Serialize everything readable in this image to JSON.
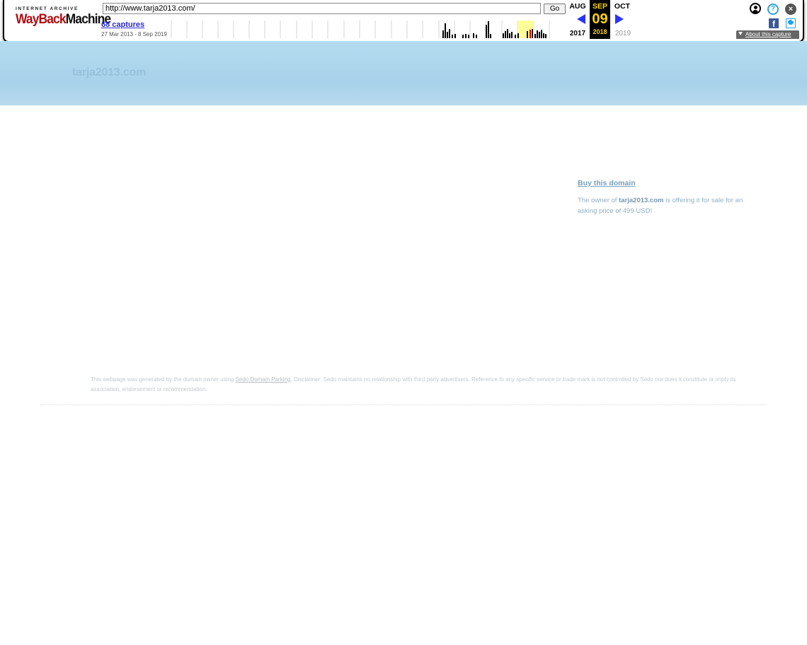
{
  "wayback": {
    "logo_top": "INTERNET ARCHIVE",
    "logo_wayback": "WayBack",
    "logo_machine": "Machine",
    "url_value": "http://www.tarja2013.com/",
    "go_label": "Go",
    "captures_label": "68 captures",
    "date_range": "27 Mar 2013 - 8 Sep 2019",
    "prev_month": "AUG",
    "current_month": "SEP",
    "next_month": "OCT",
    "current_day": "09",
    "prev_year": "2017",
    "current_year": "2018",
    "next_year": "2019",
    "about_label": "About this capture",
    "help_glyph": "?",
    "close_glyph": "×",
    "fb_glyph": "f",
    "accent_color": "#2b34ff",
    "highlight_color": "#ffd800",
    "icons": [
      "user-icon",
      "help-icon",
      "close-icon",
      "facebook-icon",
      "twitter-icon",
      "prev-arrow-icon",
      "next-arrow-icon",
      "caret-down-icon"
    ]
  },
  "site": {
    "title": "tarja2013.com",
    "buy_link": "Buy this domain",
    "offer_prefix": "The owner of ",
    "offer_domain": "tarja2013.com",
    "offer_suffix": " is offering it for sale for an asking price of 499 USD!",
    "disclaimer_prefix": "This webpage was generated by the domain owner using ",
    "disclaimer_link": "Sedo Domain Parking",
    "disclaimer_suffix": ". Disclaimer: Sedo maintains no relationship with third party advertisers. Reference to any specific service or trade mark is not controlled by Sedo nor does it constitute or imply its association, endorsement or recommendation."
  }
}
